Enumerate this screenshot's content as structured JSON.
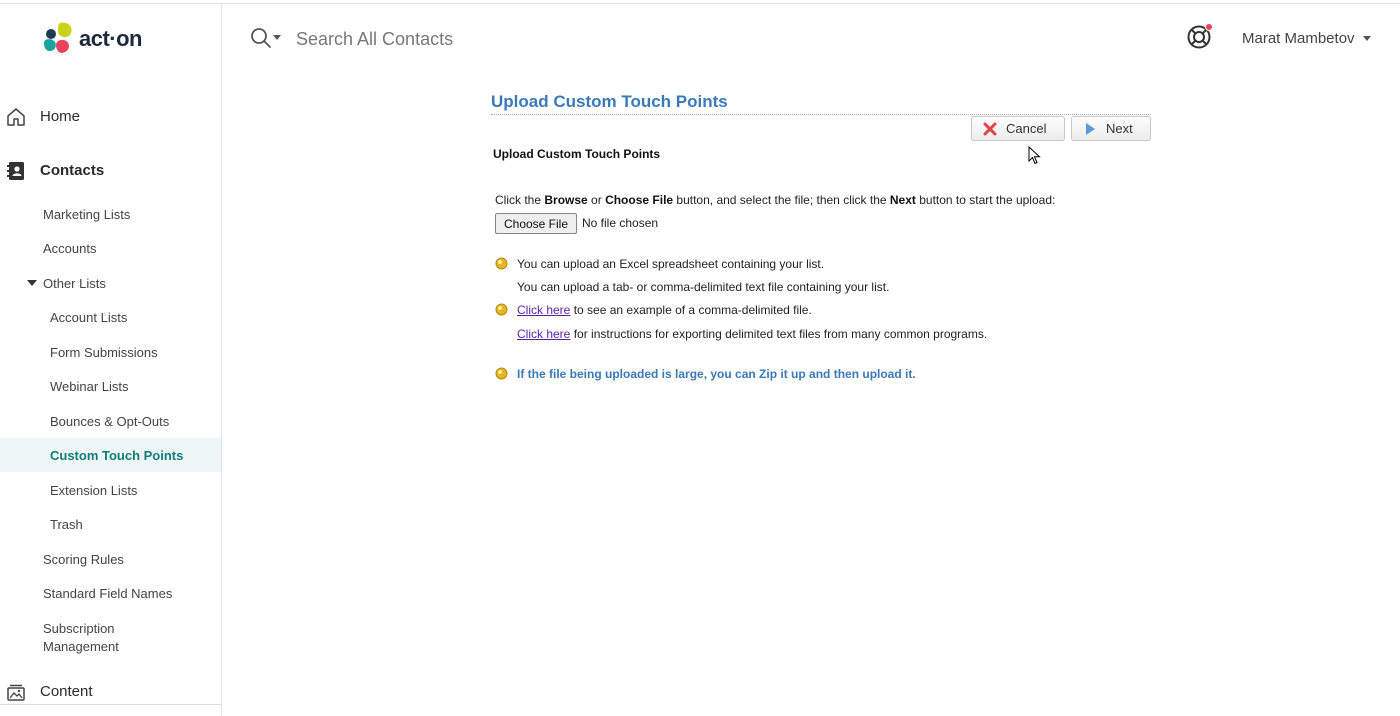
{
  "app": {
    "logo_text": "act·on"
  },
  "header": {
    "search_placeholder": "Search All Contacts",
    "user_name": "Marat Mambetov"
  },
  "sidebar": {
    "home": "Home",
    "contacts": "Contacts",
    "marketing_lists": "Marketing Lists",
    "accounts": "Accounts",
    "other_lists": "Other Lists",
    "account_lists": "Account Lists",
    "form_submissions": "Form Submissions",
    "webinar_lists": "Webinar Lists",
    "bounces": "Bounces & Opt-Outs",
    "custom_touch_points": "Custom Touch Points",
    "extension_lists": "Extension Lists",
    "trash": "Trash",
    "scoring_rules": "Scoring Rules",
    "standard_field_names": "Standard Field Names",
    "subscription_line1": "Subscription",
    "subscription_line2": "Management",
    "content": "Content"
  },
  "main": {
    "title": "Upload Custom Touch Points",
    "cancel_label": "Cancel",
    "next_label": "Next",
    "section_title": "Upload Custom Touch Points",
    "instr_1": "Click the ",
    "instr_browse": "Browse",
    "instr_2": " or ",
    "instr_choose": "Choose File",
    "instr_3": " button, and select the file; then click the ",
    "instr_next": "Next",
    "instr_4": " button to start the upload:",
    "choose_file_label": "Choose File",
    "file_status": "No file chosen",
    "note_excel": "You can upload an Excel spreadsheet containing your list.",
    "note_tab": "You can upload a tab- or comma-delimited text file containing your list.",
    "click_here_1": "Click here",
    "note_example": " to see an example of a comma-delimited file.",
    "click_here_2": "Click here",
    "note_instructions": " for instructions for exporting delimited text files from many common programs.",
    "note_zip": "If the file being uploaded is large, you can Zip it up and then upload it."
  },
  "colors": {
    "accent_blue": "#3a7ab8",
    "active_teal": "#137b7c",
    "active_bg": "#eef7f6",
    "link_purple": "#5a1fa8"
  },
  "icons": [
    "search-icon",
    "help-lifebuoy-icon",
    "home-icon",
    "contacts-icon",
    "content-icon",
    "cancel-x-icon",
    "next-arrow-icon",
    "bullet-icon",
    "mouse-cursor-icon"
  ]
}
